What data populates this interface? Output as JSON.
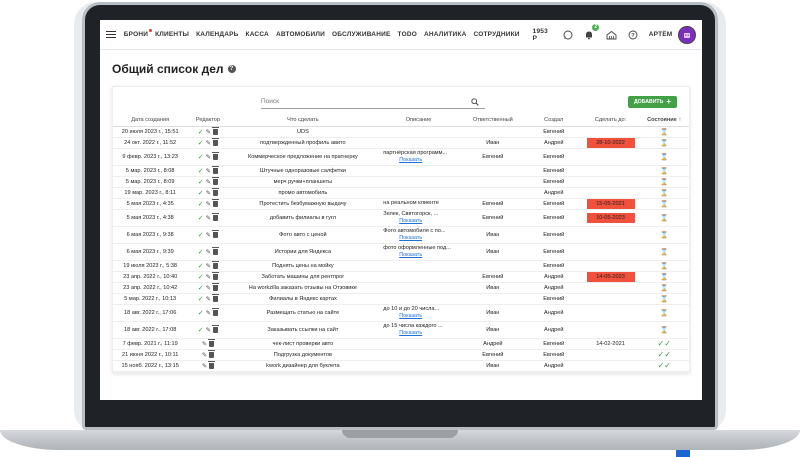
{
  "nav": {
    "items": [
      "БРОНИ",
      "КЛИЕНТЫ",
      "КАЛЕНДАРЬ",
      "КАССА",
      "АВТОМОБИЛИ",
      "ОБСЛУЖИВАНИЕ",
      "TODO",
      "АНАЛИТИКА",
      "СОТРУДНИКИ"
    ],
    "balance": "1953 Р",
    "notifications_count": "2",
    "user_name": "АРТЁМ"
  },
  "page": {
    "title": "Общий список дел",
    "search_placeholder": "Поиск",
    "add_button": "ДОБАВИТЬ"
  },
  "table": {
    "headers": [
      "Дата создания",
      "Редактор",
      "Что сделать",
      "Описание",
      "Ответственный",
      "Создал",
      "Сделать до:",
      "Состояние"
    ],
    "rows": [
      {
        "date": "20 июля 2023 г., 15:51",
        "todo": "UDS",
        "desc": "",
        "link": "",
        "resp": "",
        "creator": "Евгений",
        "due": "",
        "overdue": false,
        "done": false,
        "check": true
      },
      {
        "date": "24 окт. 2022 г., 11:52",
        "todo": "подтвержденный профиль авито",
        "desc": "",
        "link": "",
        "resp": "Иван",
        "creator": "Андрей",
        "due": "28-10-2022",
        "overdue": true,
        "done": false,
        "check": true
      },
      {
        "date": "9 февр. 2023 г., 13:23",
        "todo": "Коммерческое предложение на пратнерку",
        "desc": "партнёрская программ...",
        "link": "Показать",
        "resp": "Евгений",
        "creator": "Евгений",
        "due": "",
        "overdue": false,
        "done": false,
        "check": true
      },
      {
        "date": "5 мар. 2023 г., 8:08",
        "todo": "Штучные одноразовые салфетки",
        "desc": "",
        "link": "",
        "resp": "",
        "creator": "Евгений",
        "due": "",
        "overdue": false,
        "done": false,
        "check": true
      },
      {
        "date": "5 мар. 2023 г., 8:09",
        "todo": "мерч ручки+планшеты",
        "desc": "",
        "link": "",
        "resp": "",
        "creator": "Евгений",
        "due": "",
        "overdue": false,
        "done": false,
        "check": true
      },
      {
        "date": "19 мар. 2023 г., 8:11",
        "todo": "промо автомобиль",
        "desc": "",
        "link": "",
        "resp": "",
        "creator": "Андрей",
        "due": "",
        "overdue": false,
        "done": false,
        "check": true
      },
      {
        "date": "5 мая 2023 г., 4:35",
        "todo": "Протестить безбумажную выдачу",
        "desc": "на реальном клиенте",
        "link": "",
        "resp": "Евгений",
        "creator": "Евгений",
        "due": "15-05-2021",
        "overdue": true,
        "done": false,
        "check": true
      },
      {
        "date": "5 мая 2023 г., 4:38",
        "todo": "добавить филиалы в гугл",
        "desc": "Зелек, Святогорск, ...",
        "link": "Показать",
        "resp": "Евгений",
        "creator": "Евгений",
        "due": "10-05-2023",
        "overdue": true,
        "done": false,
        "check": true
      },
      {
        "date": "6 мая 2023 г., 9:38",
        "todo": "Фото авто с ценой",
        "desc": "Фото автомобиля с по...",
        "link": "Показать",
        "resp": "Иван",
        "creator": "Евгений",
        "due": "",
        "overdue": false,
        "done": false,
        "check": true
      },
      {
        "date": "6 мая 2023 г., 9:39",
        "todo": "Истории для Яндекса",
        "desc": "фото оформленные под...",
        "link": "Показать",
        "resp": "Иван",
        "creator": "Евгений",
        "due": "",
        "overdue": false,
        "done": false,
        "check": true
      },
      {
        "date": "19 июля 2023 г., 5:38",
        "todo": "Поднять цены на мойку",
        "desc": "",
        "link": "",
        "resp": "",
        "creator": "Евгений",
        "due": "",
        "overdue": false,
        "done": false,
        "check": true
      },
      {
        "date": "23 апр. 2022 г., 10:40",
        "todo": "Заботать машины для рентпрог",
        "desc": "",
        "link": "",
        "resp": "Евгений",
        "creator": "Андрей",
        "due": "14-05-2023",
        "overdue": true,
        "done": false,
        "check": true
      },
      {
        "date": "23 апр. 2022 г., 10:42",
        "todo": "На workzilla заказать отзывы на Отзовике",
        "desc": "",
        "link": "",
        "resp": "Иван",
        "creator": "Андрей",
        "due": "",
        "overdue": false,
        "done": false,
        "check": true
      },
      {
        "date": "5 мар. 2022 г., 10:13",
        "todo": "Филиалы в Яндекс картах",
        "desc": "",
        "link": "",
        "resp": "",
        "creator": "Евгений",
        "due": "",
        "overdue": false,
        "done": false,
        "check": true
      },
      {
        "date": "18 авг. 2022 г., 17:06",
        "todo": "Размещать статью на сайте",
        "desc": "до 10 и до 20 числа...",
        "link": "Показать",
        "resp": "Иван",
        "creator": "Андрей",
        "due": "",
        "overdue": false,
        "done": false,
        "check": true
      },
      {
        "date": "18 авг. 2022 г., 17:08",
        "todo": "Заказывать ссылки на сайт",
        "desc": "до 15 числа каждого ...",
        "link": "Показать",
        "resp": "Иван",
        "creator": "Андрей",
        "due": "",
        "overdue": false,
        "done": false,
        "check": true
      },
      {
        "date": "7 февр. 2021 г., 11:19",
        "todo": "чек-лист проверки авто",
        "desc": "",
        "link": "",
        "resp": "Андрей",
        "creator": "Евгений",
        "due": "14-02-2021",
        "overdue": false,
        "done": true,
        "check": false
      },
      {
        "date": "21 июня 2022 г., 10:11",
        "todo": "Подгрузка документов",
        "desc": "",
        "link": "",
        "resp": "Евгений",
        "creator": "Евгений",
        "due": "",
        "overdue": false,
        "done": true,
        "check": false
      },
      {
        "date": "15 нояб. 2022 г., 13:15",
        "todo": "kwork дизайнер для буклета",
        "desc": "",
        "link": "",
        "resp": "Иван",
        "creator": "Андрей",
        "due": "",
        "overdue": false,
        "done": true,
        "check": false
      }
    ]
  }
}
